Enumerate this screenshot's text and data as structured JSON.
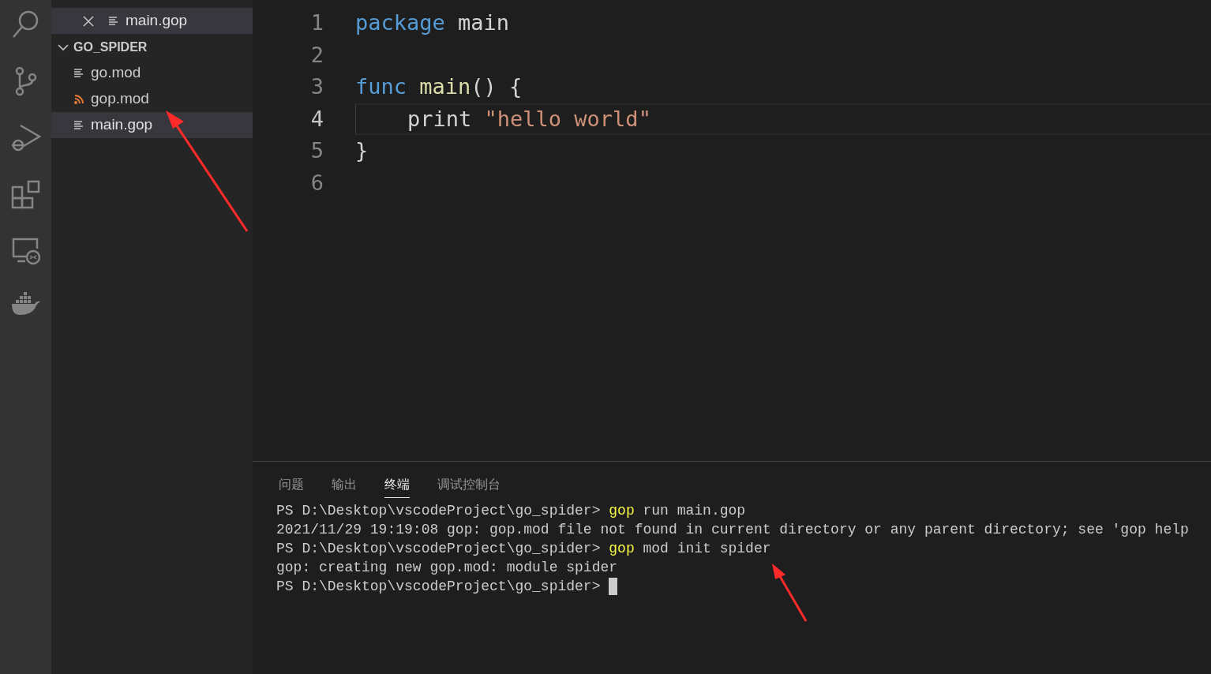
{
  "sidebar": {
    "open_editors": [
      {
        "name": "main.gop",
        "kind": "text",
        "selected": true
      }
    ],
    "folder": {
      "name": "GO_SPIDER",
      "expanded": true,
      "children": [
        {
          "name": "go.mod",
          "kind": "text",
          "selected": false
        },
        {
          "name": "gop.mod",
          "kind": "feed",
          "selected": false
        },
        {
          "name": "main.gop",
          "kind": "text",
          "selected": true
        }
      ]
    }
  },
  "editor": {
    "lines": [
      {
        "number": "1",
        "current": false,
        "tokens": [
          {
            "kind": "keyword",
            "text": "package "
          },
          {
            "kind": "plain",
            "text": "main"
          }
        ]
      },
      {
        "number": "2",
        "current": false
      },
      {
        "number": "3",
        "current": false,
        "tokens": [
          {
            "kind": "keyword",
            "text": "func "
          },
          {
            "kind": "function",
            "text": "main"
          },
          {
            "kind": "plain",
            "text": "() {"
          }
        ]
      },
      {
        "number": "4",
        "current": true,
        "tokens": [
          {
            "kind": "plain",
            "text": "    print "
          },
          {
            "kind": "string",
            "text": "\"hello world\""
          }
        ]
      },
      {
        "number": "5",
        "current": false,
        "tokens": [
          {
            "kind": "plain",
            "text": "}"
          }
        ]
      },
      {
        "number": "6",
        "current": false
      }
    ]
  },
  "panel": {
    "tabs": [
      {
        "label": "问题",
        "selected": false
      },
      {
        "label": "输出",
        "selected": false
      },
      {
        "label": "终端",
        "selected": true
      },
      {
        "label": "调试控制台",
        "selected": false
      }
    ],
    "terminal": [
      [
        {
          "kind": "text",
          "text": "PS D:\\Desktop\\vscodeProject\\go_spider> "
        },
        {
          "kind": "command",
          "text": "gop"
        },
        {
          "kind": "text",
          "text": " run main.gop"
        }
      ],
      [
        {
          "kind": "text",
          "text": "2021/11/29 19:19:08 gop: gop.mod file not found in current directory or any parent directory; see 'gop help"
        }
      ],
      [
        {
          "kind": "text",
          "text": "PS D:\\Desktop\\vscodeProject\\go_spider> "
        },
        {
          "kind": "command",
          "text": "gop"
        },
        {
          "kind": "text",
          "text": " mod init spider"
        }
      ],
      [
        {
          "kind": "text",
          "text": "gop: creating new gop.mod: module spider"
        }
      ],
      [
        {
          "kind": "text",
          "text": "PS D:\\Desktop\\vscodeProject\\go_spider> "
        },
        {
          "kind": "cursor"
        }
      ]
    ]
  }
}
